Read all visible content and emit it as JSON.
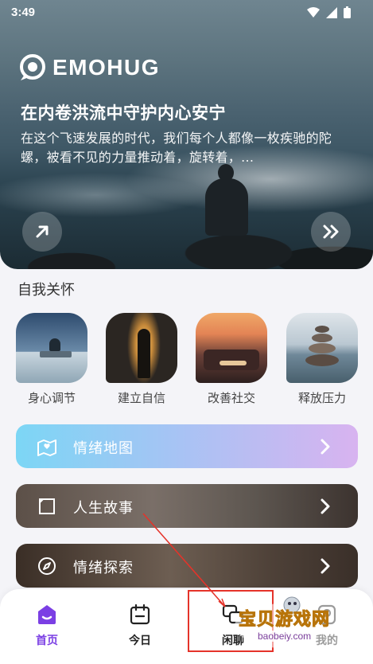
{
  "status_bar": {
    "time": "3:49"
  },
  "hero": {
    "logo_text": "EMOHUG",
    "title": "在内卷洪流中守护内心安宁",
    "description": "在这个飞速发展的时代，我们每个人都像一枚疾驰的陀螺，被看不见的力量推动着，旋转着，...",
    "left_button_icon": "arrow-up-right-icon",
    "right_button_icon": "double-chevron-right-icon"
  },
  "self_care": {
    "title": "自我关怀",
    "items": [
      {
        "label": "身心调节"
      },
      {
        "label": "建立自信"
      },
      {
        "label": "改善社交"
      },
      {
        "label": "释放压力"
      }
    ]
  },
  "menu": {
    "mood_map": {
      "label": "情绪地图",
      "icon": "map-icon"
    },
    "life_story": {
      "label": "人生故事",
      "icon": "book-icon"
    },
    "mood_explore": {
      "label": "情绪探索",
      "icon": "compass-icon"
    }
  },
  "tabs": [
    {
      "label": "首页",
      "icon": "home-icon",
      "active": true
    },
    {
      "label": "今日",
      "icon": "calendar-icon",
      "active": false
    },
    {
      "label": "闲聊",
      "icon": "chat-icon",
      "active": false
    },
    {
      "label": "我的",
      "icon": "profile-icon",
      "active": false
    }
  ],
  "colors": {
    "accent": "#7b3fe4",
    "annotation": "#e5332a"
  },
  "watermark": {
    "text": "宝贝游戏网",
    "url": "baobeiy.com"
  }
}
